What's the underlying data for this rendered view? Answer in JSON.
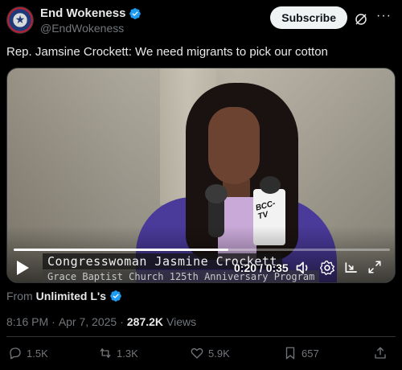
{
  "header": {
    "display_name": "End Wokeness",
    "handle": "@EndWokeness",
    "subscribe_label": "Subscribe",
    "avatar_icon": "end-wokeness-seal-avatar",
    "verified_icon": "verified-badge-icon",
    "verified_color": "#1d9bf0"
  },
  "tweet": {
    "text": "Rep. Jamsine Crockett: We need migrants to pick our cotton"
  },
  "video": {
    "lower_third_name": "Congresswoman Jasmine Crockett",
    "lower_third_sub": "Grace Baptist Church 125th Anniversary Program",
    "mic_label": "BCC-TV",
    "current_time": "0:20",
    "duration": "0:35",
    "time_display": "0:20 / 0:35",
    "progress_fraction": 0.57
  },
  "source": {
    "prefix": "From",
    "name": "Unlimited L's"
  },
  "meta": {
    "time": "8:16 PM",
    "separator1": "·",
    "date": "Apr 7, 2025",
    "separator2": "·",
    "views_count": "287.2K",
    "views_label": "Views"
  },
  "actions": {
    "replies": "1.5K",
    "reposts": "1.3K",
    "likes": "5.9K",
    "bookmarks": "657"
  }
}
